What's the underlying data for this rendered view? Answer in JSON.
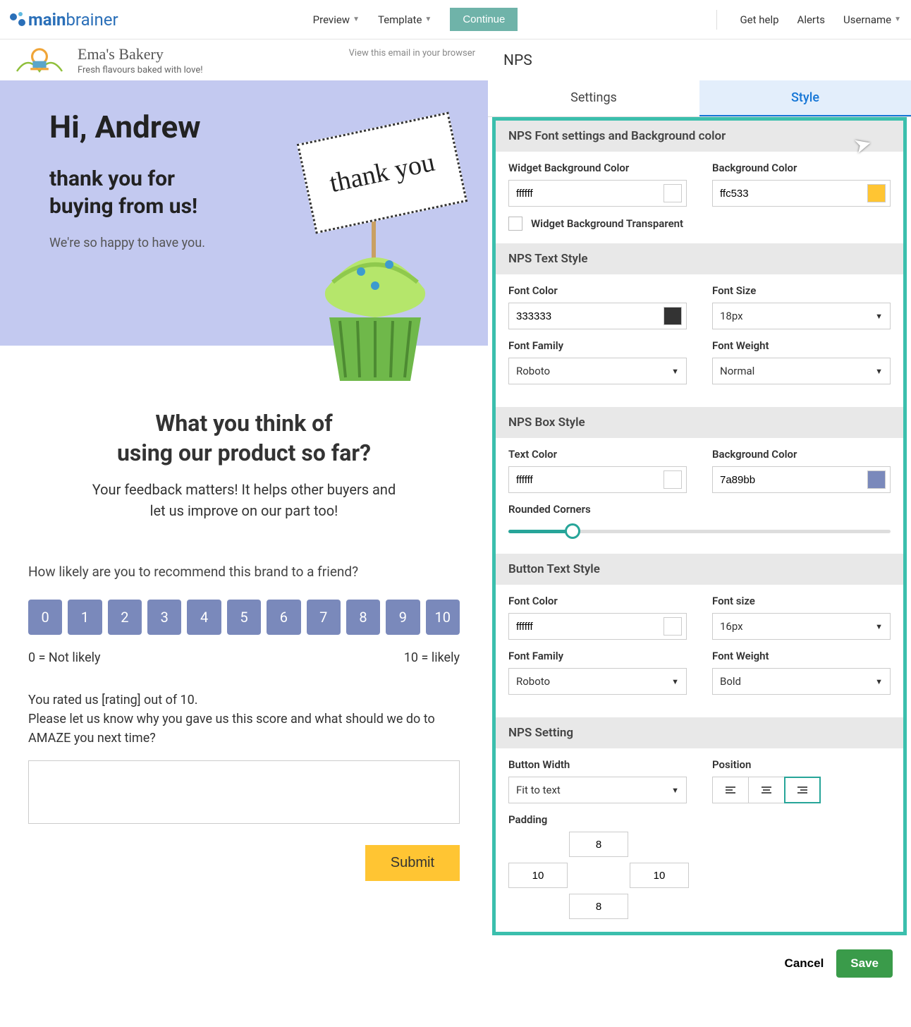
{
  "header": {
    "logo_main": "main",
    "logo_brainer": "brainer",
    "preview": "Preview",
    "template": "Template",
    "continue": "Continue",
    "get_help": "Get help",
    "alerts": "Alerts",
    "username": "Username"
  },
  "email": {
    "view_browser": "View this email in your browser",
    "bakery_name": "Ema's Bakery",
    "bakery_tag": "Fresh flavours baked with love!",
    "thank_card": "thank you",
    "greeting": "Hi, Andrew",
    "thanks_line1": "thank you for",
    "thanks_line2": "buying from us!",
    "happy": "We're so happy to have you.",
    "survey_h1": "What you think of",
    "survey_h2": "using our product so far?",
    "survey_sub1": "Your feedback matters! It helps other buyers and",
    "survey_sub2": "let us improve on our part too!",
    "nps_question": "How likely are you to recommend this brand to a friend?",
    "scale": [
      "0",
      "1",
      "2",
      "3",
      "4",
      "5",
      "6",
      "7",
      "8",
      "9",
      "10"
    ],
    "label_low": "0 = Not likely",
    "label_high": "10 = likely",
    "rated_line1": "You rated us [rating] out of 10.",
    "rated_line2": "Please let us know why you gave us this score and what should we do to AMAZE you next time?",
    "submit": "Submit"
  },
  "panel": {
    "title": "NPS",
    "tab_settings": "Settings",
    "tab_style": "Style",
    "sec1": {
      "title": "NPS Font settings and Background color",
      "widget_bg_label": "Widget Background Color",
      "widget_bg_value": "ffffff",
      "bg_label": "Background Color",
      "bg_value": "ffc533",
      "transparent": "Widget Background Transparent"
    },
    "sec2": {
      "title": "NPS Text Style",
      "font_color_label": "Font Color",
      "font_color_value": "333333",
      "font_size_label": "Font Size",
      "font_size_value": "18px",
      "font_family_label": "Font Family",
      "font_family_value": "Roboto",
      "font_weight_label": "Font Weight",
      "font_weight_value": "Normal"
    },
    "sec3": {
      "title": "NPS Box Style",
      "text_color_label": "Text Color",
      "text_color_value": "ffffff",
      "bg_label": "Background Color",
      "bg_value": "7a89bb",
      "rounded_label": "Rounded Corners"
    },
    "sec4": {
      "title": "Button Text Style",
      "font_color_label": "Font Color",
      "font_color_value": "ffffff",
      "font_size_label": "Font size",
      "font_size_value": "16px",
      "font_family_label": "Font Family",
      "font_family_value": "Roboto",
      "font_weight_label": "Font Weight",
      "font_weight_value": "Bold"
    },
    "sec5": {
      "title": "NPS Setting",
      "button_width_label": "Button Width",
      "button_width_value": "Fit to text",
      "position_label": "Position",
      "padding_label": "Padding",
      "pad_top": "8",
      "pad_left": "10",
      "pad_right": "10",
      "pad_bottom": "8"
    },
    "cancel": "Cancel",
    "save": "Save"
  }
}
